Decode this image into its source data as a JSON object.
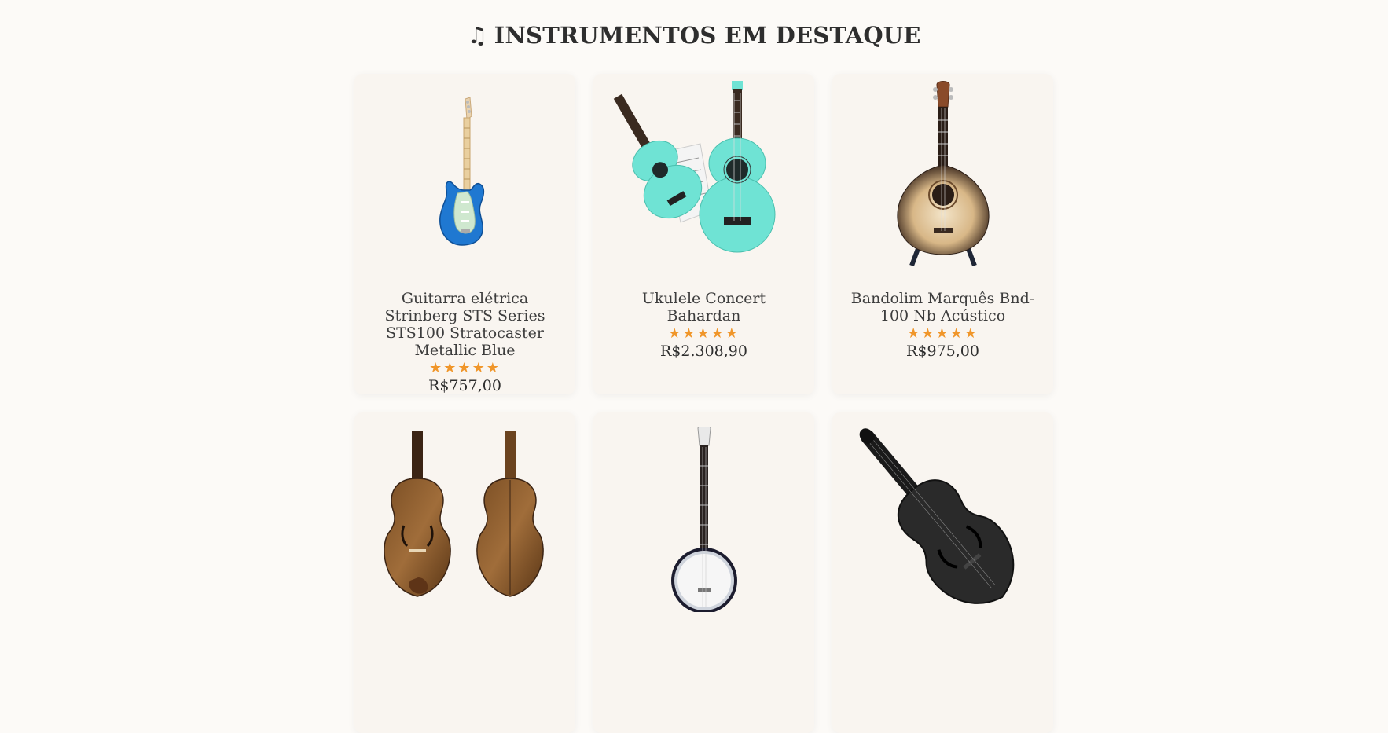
{
  "section": {
    "title": "INSTRUMENTOS EM DESTAQUE",
    "title_icon": "music-note-icon"
  },
  "colors": {
    "background": "#fcfaf7",
    "card": "#f9f5f0",
    "star": "#f0962a"
  },
  "products": [
    {
      "name": "Guitarra elétrica Strinberg STS Series STS100 Stratocaster Metallic Blue",
      "rating": 5,
      "stars": "★★★★★",
      "price": "R$757,00",
      "image": "electric-guitar-image"
    },
    {
      "name": "Ukulele Concert Bahardan",
      "rating": 5,
      "stars": "★★★★★",
      "price": "R$2.308,90",
      "image": "ukulele-image"
    },
    {
      "name": "Bandolim Marquês Bnd-100 Nb Acústico",
      "rating": 5,
      "stars": "★★★★★",
      "price": "R$975,00",
      "image": "mandolin-image"
    },
    {
      "name": "",
      "image": "violin-image"
    },
    {
      "name": "",
      "image": "banjo-image"
    },
    {
      "name": "",
      "image": "black-violin-image"
    }
  ]
}
